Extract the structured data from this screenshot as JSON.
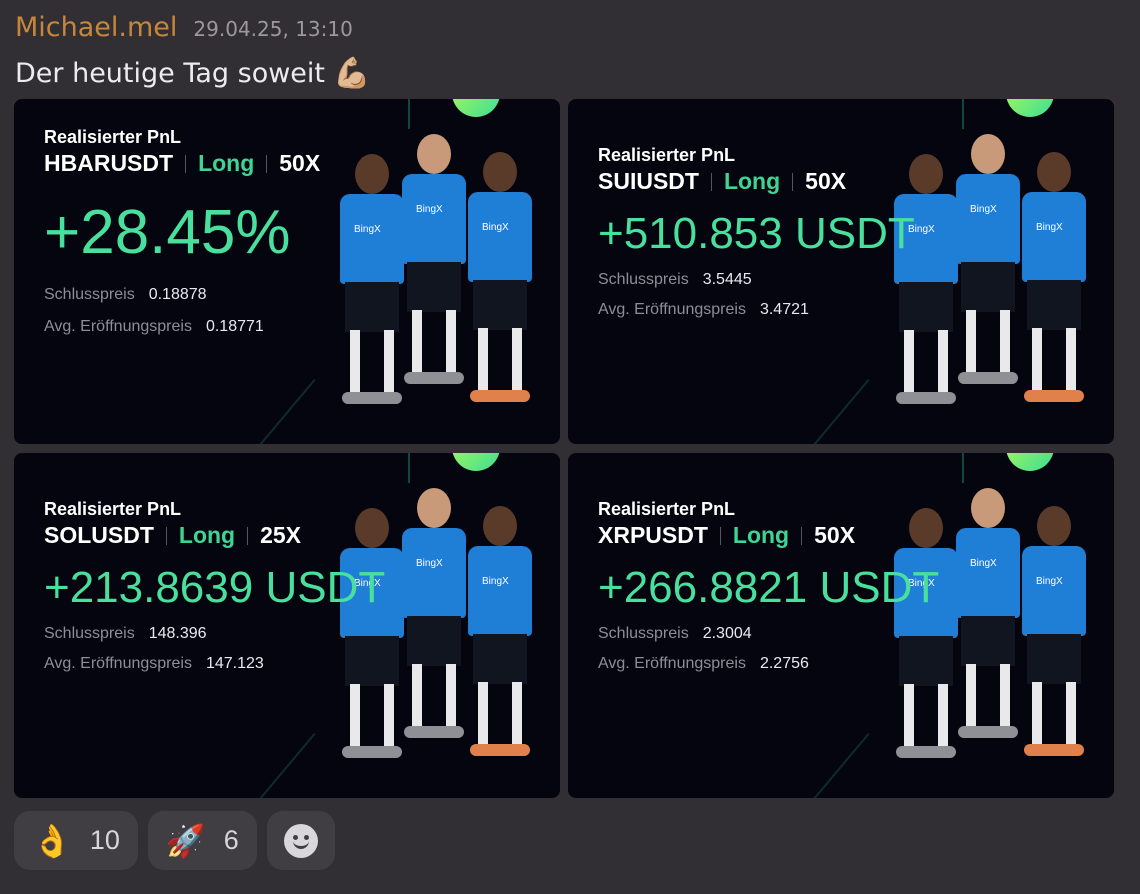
{
  "message": {
    "author": "Michael.mel",
    "timestamp": "29.04.25, 13:10",
    "text": "Der heutige Tag soweit",
    "text_emoji": "💪🏼"
  },
  "cards": [
    {
      "label": "Realisierter PnL",
      "pair": "HBARUSDT",
      "direction": "Long",
      "leverage": "50X",
      "pnl": "+28.45%",
      "close_label": "Schlusspreis",
      "close_price": "0.18878",
      "open_label": "Avg. Eröffnungspreis",
      "open_price": "0.18771"
    },
    {
      "label": "Realisierter PnL",
      "pair": "SUIUSDT",
      "direction": "Long",
      "leverage": "50X",
      "pnl": "+510.853 USDT",
      "close_label": "Schlusspreis",
      "close_price": "3.5445",
      "open_label": "Avg. Eröffnungspreis",
      "open_price": "3.4721"
    },
    {
      "label": "Realisierter PnL",
      "pair": "SOLUSDT",
      "direction": "Long",
      "leverage": "25X",
      "pnl": "+213.8639 USDT",
      "close_label": "Schlusspreis",
      "close_price": "148.396",
      "open_label": "Avg. Eröffnungspreis",
      "open_price": "147.123"
    },
    {
      "label": "Realisierter PnL",
      "pair": "XRPUSDT",
      "direction": "Long",
      "leverage": "50X",
      "pnl": "+266.8821 USDT",
      "close_label": "Schlusspreis",
      "close_price": "2.3004",
      "open_label": "Avg. Eröffnungspreis",
      "open_price": "2.2756"
    }
  ],
  "jersey_brand": "BingX",
  "reactions": [
    {
      "emoji": "👌",
      "icon": "ok-hand-icon",
      "count": "10"
    },
    {
      "emoji": "🚀",
      "icon": "rocket-icon",
      "count": "6"
    }
  ],
  "add_reaction_icon": "smiley-icon",
  "colors": {
    "author": "#c6873a",
    "pnl_green": "#48e09c",
    "long_green": "#3fd494",
    "card_bg": "#05050f",
    "app_bg": "#312f33",
    "jersey_blue": "#1f7fd6"
  }
}
